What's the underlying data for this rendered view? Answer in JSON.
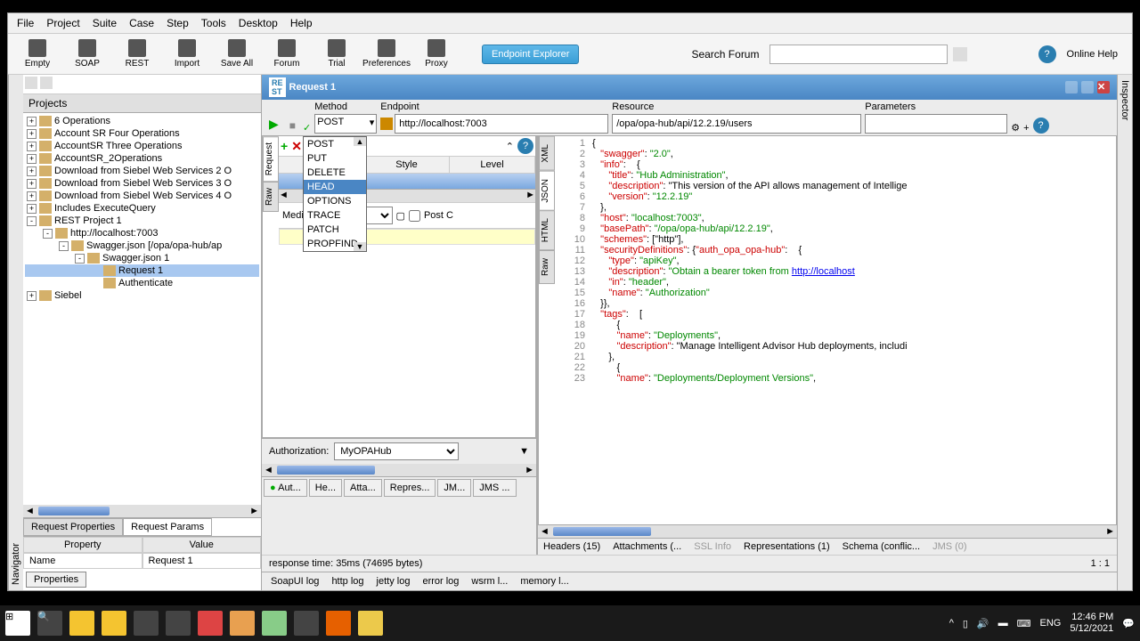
{
  "menubar": [
    "File",
    "Project",
    "Suite",
    "Case",
    "Step",
    "Tools",
    "Desktop",
    "Help"
  ],
  "toolbar_buttons": [
    "Empty",
    "SOAP",
    "REST",
    "Import",
    "Save All",
    "Forum",
    "Trial",
    "Preferences",
    "Proxy"
  ],
  "endpoint_explorer": "Endpoint Explorer",
  "search_label": "Search Forum",
  "online_help": "Online Help",
  "projects_title": "Projects",
  "navigator_tab": "Navigator",
  "inspector_tab": "Inspector",
  "tree": [
    {
      "indent": 0,
      "exp": "+",
      "label": "6 Operations"
    },
    {
      "indent": 0,
      "exp": "+",
      "label": "Account SR Four Operations"
    },
    {
      "indent": 0,
      "exp": "+",
      "label": "AccountSR Three Operations"
    },
    {
      "indent": 0,
      "exp": "+",
      "label": "AccountSR_2Operations"
    },
    {
      "indent": 0,
      "exp": "+",
      "label": "Download from Siebel Web Services 2 O"
    },
    {
      "indent": 0,
      "exp": "+",
      "label": "Download from Siebel Web Services 3 O"
    },
    {
      "indent": 0,
      "exp": "+",
      "label": "Download from Siebel Web Services 4 O"
    },
    {
      "indent": 0,
      "exp": "+",
      "label": "Includes ExecuteQuery"
    },
    {
      "indent": 0,
      "exp": "-",
      "label": "REST Project 1"
    },
    {
      "indent": 1,
      "exp": "-",
      "label": "http://localhost:7003",
      "icon": "globe"
    },
    {
      "indent": 2,
      "exp": "-",
      "label": "Swagger.json [/opa/opa-hub/ap"
    },
    {
      "indent": 3,
      "exp": "-",
      "label": "Swagger.json 1"
    },
    {
      "indent": 4,
      "exp": "",
      "label": "Request 1",
      "sel": true
    },
    {
      "indent": 4,
      "exp": "",
      "label": "Authenticate"
    },
    {
      "indent": 0,
      "exp": "+",
      "label": "Siebel"
    }
  ],
  "prop_tabs": {
    "t1": "Request Properties",
    "t2": "Request Params"
  },
  "prop_headers": {
    "c1": "Property",
    "c2": "Value"
  },
  "prop_row": {
    "name": "Name",
    "value": "Request 1"
  },
  "properties_btn": "Properties",
  "request_title": "Request 1",
  "labels": {
    "method": "Method",
    "endpoint": "Endpoint",
    "resource": "Resource",
    "parameters": "Parameters"
  },
  "method_value": "POST",
  "endpoint_value": "http://localhost:7003",
  "resource_value": "/opa/opa-hub/api/12.2.19/users",
  "side_tabs_left": [
    "Request",
    "Raw"
  ],
  "param_headers": {
    "name": "Nam",
    "style": "Style",
    "level": "Level"
  },
  "media_label": "Media T",
  "media_value": "/json",
  "post_c": "Post C",
  "method_options": [
    "POST",
    "PUT",
    "DELETE",
    "HEAD",
    "OPTIONS",
    "TRACE",
    "PATCH",
    "PROPFIND"
  ],
  "method_hover": "HEAD",
  "auth_label": "Authorization:",
  "auth_value": "MyOPAHub",
  "req_bottom_tabs": [
    "Aut...",
    "He...",
    "Atta...",
    "Repres...",
    "JM...",
    "JMS ..."
  ],
  "resp_tabs": [
    "XML",
    "JSON",
    "HTML",
    "Raw"
  ],
  "json_lines": [
    {
      "n": 1,
      "t": "{"
    },
    {
      "n": 2,
      "t": "   \"swagger\": \"2.0\","
    },
    {
      "n": 3,
      "t": "   \"info\":    {"
    },
    {
      "n": 4,
      "t": "      \"title\": \"Hub Administration\","
    },
    {
      "n": 5,
      "t": "      \"description\": \"This version of the API allows management of Intellige"
    },
    {
      "n": 6,
      "t": "      \"version\": \"12.2.19\""
    },
    {
      "n": 7,
      "t": "   },"
    },
    {
      "n": 8,
      "t": "   \"host\": \"localhost:7003\","
    },
    {
      "n": 9,
      "t": "   \"basePath\": \"/opa/opa-hub/api/12.2.19\","
    },
    {
      "n": 10,
      "t": "   \"schemes\": [\"http\"],"
    },
    {
      "n": 11,
      "t": "   \"securityDefinitions\": {\"auth_opa_opa-hub\":    {"
    },
    {
      "n": 12,
      "t": "      \"type\": \"apiKey\","
    },
    {
      "n": 13,
      "t": "      \"description\": \"Obtain a bearer token from <a href=\\\"http://localhost"
    },
    {
      "n": 14,
      "t": "      \"in\": \"header\","
    },
    {
      "n": 15,
      "t": "      \"name\": \"Authorization\""
    },
    {
      "n": 16,
      "t": "   }},"
    },
    {
      "n": 17,
      "t": "   \"tags\":    ["
    },
    {
      "n": 18,
      "t": "         {"
    },
    {
      "n": 19,
      "t": "         \"name\": \"Deployments\","
    },
    {
      "n": 20,
      "t": "         \"description\": \"Manage Intelligent Advisor Hub deployments, includi"
    },
    {
      "n": 21,
      "t": "      },"
    },
    {
      "n": 22,
      "t": "         {"
    },
    {
      "n": 23,
      "t": "         \"name\": \"Deployments/Deployment Versions\","
    }
  ],
  "resp_bottom_tabs": [
    "Headers (15)",
    "Attachments (...",
    "SSL Info",
    "Representations (1)",
    "Schema (conflic...",
    "JMS (0)"
  ],
  "status_text": "response time: 35ms (74695 bytes)",
  "status_ratio": "1 : 1",
  "log_tabs": [
    "SoapUI log",
    "http log",
    "jetty log",
    "error log",
    "wsrm l...",
    "memory l..."
  ],
  "sys": {
    "lang": "ENG",
    "time": "12:46 PM",
    "date": "5/12/2021"
  }
}
